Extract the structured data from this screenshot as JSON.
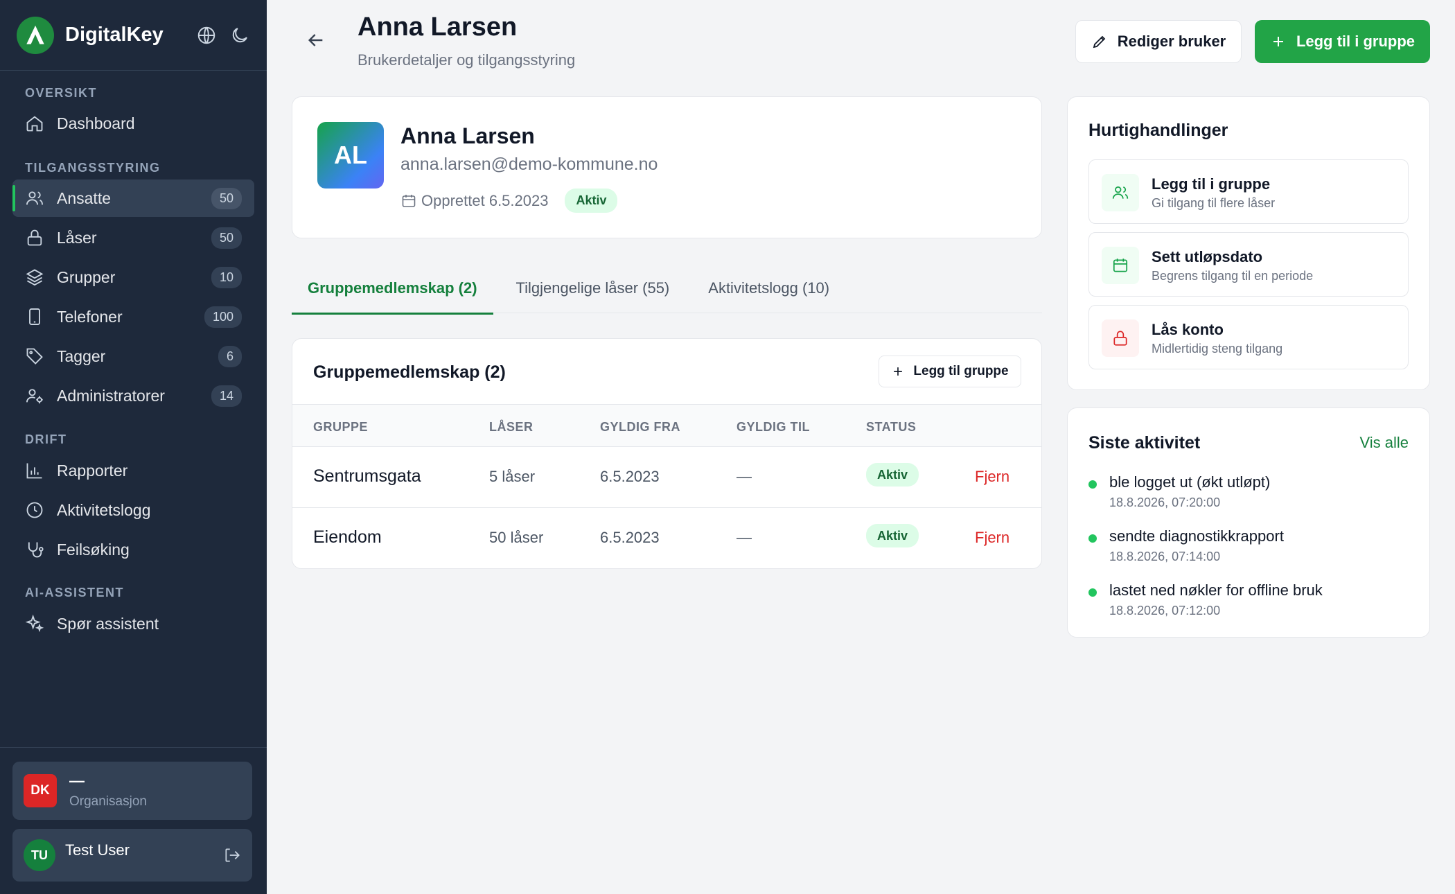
{
  "sidebar": {
    "brand": "DigitalKey",
    "sections": [
      {
        "title": "OVERSIKT",
        "items": [
          {
            "label": "Dashboard",
            "icon": "home-icon",
            "count": null
          }
        ]
      },
      {
        "title": "TILGANGSSTYRING",
        "items": [
          {
            "label": "Ansatte",
            "icon": "users-icon",
            "count": "50",
            "active": true
          },
          {
            "label": "Låser",
            "icon": "lock-icon",
            "count": "50"
          },
          {
            "label": "Grupper",
            "icon": "layers-icon",
            "count": "10"
          },
          {
            "label": "Telefoner",
            "icon": "phone-icon",
            "count": "100"
          },
          {
            "label": "Tagger",
            "icon": "tag-icon",
            "count": "6"
          },
          {
            "label": "Administratorer",
            "icon": "user-cog-icon",
            "count": "14"
          }
        ]
      },
      {
        "title": "DRIFT",
        "items": [
          {
            "label": "Rapporter",
            "icon": "bar-chart-icon"
          },
          {
            "label": "Aktivitetslogg",
            "icon": "clock-icon"
          },
          {
            "label": "Feilsøking",
            "icon": "stethoscope-icon"
          }
        ]
      },
      {
        "title": "AI-ASSISTENT",
        "items": [
          {
            "label": "Spør assistent",
            "icon": "sparkles-icon"
          }
        ]
      }
    ],
    "org": {
      "badge": "DK",
      "name": "—",
      "label": "Organisasjon"
    },
    "user": {
      "initials": "TU",
      "name": "Test User"
    }
  },
  "header": {
    "title": "Anna Larsen",
    "subtitle": "Brukerdetaljer og tilgangsstyring",
    "edit_label": "Rediger bruker",
    "add_label": "Legg til i gruppe"
  },
  "profile": {
    "initials": "AL",
    "name": "Anna Larsen",
    "email": "anna.larsen@demo-kommune.no",
    "created": "Opprettet 6.5.2023",
    "status": "Aktiv"
  },
  "tabs": [
    {
      "label": "Gruppemedlemskap (2)",
      "active": true
    },
    {
      "label": "Tilgjengelige låser (55)"
    },
    {
      "label": "Aktivitetslogg (10)"
    }
  ],
  "groups": {
    "title": "Gruppemedlemskap (2)",
    "add_label": "Legg til gruppe",
    "columns": [
      "GRUPPE",
      "LÅSER",
      "GYLDIG FRA",
      "GYLDIG TIL",
      "STATUS"
    ],
    "rows": [
      {
        "name": "Sentrumsgata",
        "locks": "5 låser",
        "from": "6.5.2023",
        "to": "—",
        "status": "Aktiv",
        "action": "Fjern"
      },
      {
        "name": "Eiendom",
        "locks": "50 låser",
        "from": "6.5.2023",
        "to": "—",
        "status": "Aktiv",
        "action": "Fjern"
      }
    ]
  },
  "quick_actions": {
    "title": "Hurtighandlinger",
    "items": [
      {
        "title": "Legg til i gruppe",
        "sub": "Gi tilgang til flere låser",
        "icon": "users-icon",
        "tone": "green"
      },
      {
        "title": "Sett utløpsdato",
        "sub": "Begrens tilgang til en periode",
        "icon": "calendar-icon",
        "tone": "green"
      },
      {
        "title": "Lås konto",
        "sub": "Midlertidig steng tilgang",
        "icon": "lock-icon",
        "tone": "red"
      }
    ]
  },
  "activity": {
    "title": "Siste aktivitet",
    "view_all": "Vis alle",
    "items": [
      {
        "text": "ble logget ut (økt utløpt)",
        "time": "18.8.2026, 07:20:00"
      },
      {
        "text": "sendte diagnostikkrapport",
        "time": "18.8.2026, 07:14:00"
      },
      {
        "text": "lastet ned nøkler for offline bruk",
        "time": "18.8.2026, 07:12:00"
      }
    ]
  },
  "colors": {
    "accent": "#22a447",
    "sidebar": "#1e293b",
    "danger": "#dc2626"
  }
}
